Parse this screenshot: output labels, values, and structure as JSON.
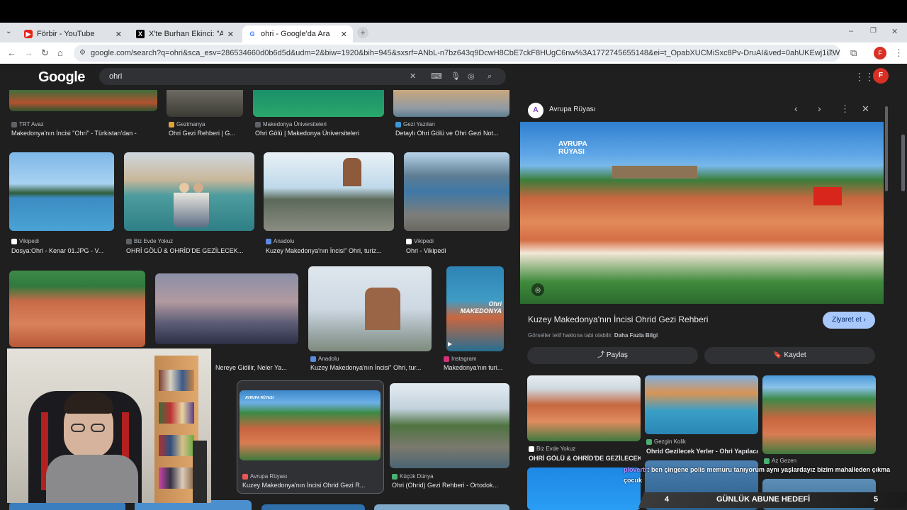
{
  "browser": {
    "tabs": [
      {
        "title": "Förbir - YouTube",
        "icon": "youtube-icon"
      },
      {
        "title": "X'te Burhan Ekinci: \"Almanya K",
        "icon": "x-icon"
      },
      {
        "title": "ohri - Google'da Ara",
        "icon": "google-icon"
      }
    ],
    "url": "google.com/search?q=ohri&sca_esv=286534660d0b6d5d&udm=2&biw=1920&bih=945&sxsrf=ANbL-n7bz643q9DcwH8CbE7ckF8HUgC6nw%3A1772745655148&ei=t_OpabXUCMiSxc8Pv-DruAI&ved=0ahUKEwj1i7WY2ImTAxVISfEDHT_wGicQ4dUD..."
  },
  "google": {
    "logo": "Google",
    "query": "ohri"
  },
  "results_row1": [
    {
      "source": "TRT Avaz",
      "title": "Makedonya'nın İncisi \"Ohri\" - Türkistan'dan -"
    },
    {
      "source": "Gezimanya",
      "title": "Ohri Gezi Rehberi | G..."
    },
    {
      "source": "Makedonya Üniversiteleri",
      "title": "Ohri Gölü | Makedonya Üniversiteleri"
    },
    {
      "source": "Gezi Yazıları",
      "title": "Detaylı Ohri Gölü ve Ohri Gezi Not..."
    }
  ],
  "results_row2": [
    {
      "source": "Vikipedi",
      "title": "Dosya:Ohri - Kenar 01.JPG - V..."
    },
    {
      "source": "Biz Evde Yokuz",
      "title": "OHRİ GÖLÜ & OHRİD'DE GEZİLECEK..."
    },
    {
      "source": "Anadolu",
      "title": "Kuzey Makedonya'nın İncisi\" Ohri, turiz..."
    },
    {
      "source": "Vikipedi",
      "title": "Ohri - Vikipedi"
    }
  ],
  "results_row3": [
    {
      "source": "",
      "title": "Nereye Gidilir, Neler Ya..."
    },
    {
      "source": "Anadolu",
      "title": "Kuzey Makedonya'nın İncisi\" Ohri, tur..."
    },
    {
      "source": "Instagram",
      "title": "Makedonya'nın turi..."
    }
  ],
  "thumb_texts": {
    "ohri_makedonya": "Ohri MAKEDONYA",
    "avrupa_small": "AVRUPA RÜYASI"
  },
  "results_row4": [
    {
      "source": "Avrupa Rüyası",
      "title": "Kuzey Makedonya'nın İncisi Ohrid Gezi R..."
    },
    {
      "source": "Küçük Dünya",
      "title": "Ohri (Ohrid) Gezi Rehberi - Ortodok..."
    }
  ],
  "panel": {
    "source": "Avrupa Rüyası",
    "title": "Kuzey Makedonya'nın İncisi Ohrid Gezi Rehberi",
    "visit_label": "Ziyaret et",
    "copyright_text": "Görseller telif hakkına tabi olabilir.",
    "more_info": "Daha Fazla Bilgi",
    "share_label": "Paylaş",
    "save_label": "Kaydet",
    "image_logo": "AVRUPA RÜYASI",
    "related": [
      {
        "source": "Biz Evde Yokuz",
        "title": "OHRİ GÖLÜ & OHRİD'DE GEZİLECEK..."
      },
      {
        "source": "Gezgin Kolik",
        "title": "Ohrid Gezilecek Yerler - Ohri Yapılacakl..."
      },
      {
        "source": "Az Gezen",
        "title": ""
      }
    ]
  },
  "stream": {
    "chat_user": "plovertr",
    "chat_message": ": ben çingene polis memuru tanıyorum aynı yaşlardayız bizim mahalleden çıkma çocuk",
    "goal_current": "4",
    "goal_label": "GÜNLÜK ABUNE HEDEFİ",
    "goal_target": "5"
  }
}
